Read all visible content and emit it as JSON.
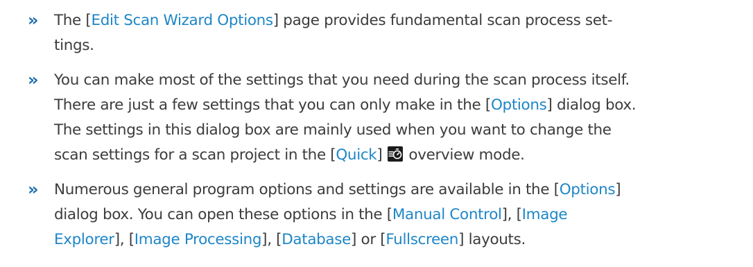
{
  "bullets": [
    {
      "marker": "»",
      "lines": [
        {
          "pre": "The [",
          "link": "Edit Scan Wizard Options",
          "post": "] page provides fundamental scan process set-"
        },
        {
          "text": "tings."
        }
      ]
    },
    {
      "marker": "»",
      "lines": [
        {
          "text": "You can make most of the settings that you need during the scan process itself."
        },
        {
          "pre": "There are just a few settings that you can only make in the [",
          "link": "Options",
          "post": "] dialog box."
        },
        {
          "text": "The settings in this dialog box are mainly used when you want to change the"
        },
        {
          "pre": "scan settings for a scan project in the [",
          "link": "Quick",
          "mid": "] ",
          "icon": "quick-overview-icon",
          "post": " overview mode."
        }
      ]
    },
    {
      "marker": "»",
      "lines": [
        {
          "pre": "Numerous general program options and settings are available in the [",
          "link": "Options",
          "post": "]"
        },
        {
          "pre": "dialog box. You can open these options in the [",
          "link": "Manual Control",
          "mid": "], [",
          "link2": "Image",
          "post": ""
        },
        {
          "link": "Explorer",
          "mid": "], [",
          "link2": "Image Processing",
          "mid2": "], [",
          "link3": "Database",
          "mid3": "] or [",
          "link4": "Fullscreen",
          "post": "] layouts."
        }
      ]
    }
  ],
  "colors": {
    "text": "#3c3c3c",
    "link": "#1e86c7",
    "marker": "#1c6fb0"
  }
}
